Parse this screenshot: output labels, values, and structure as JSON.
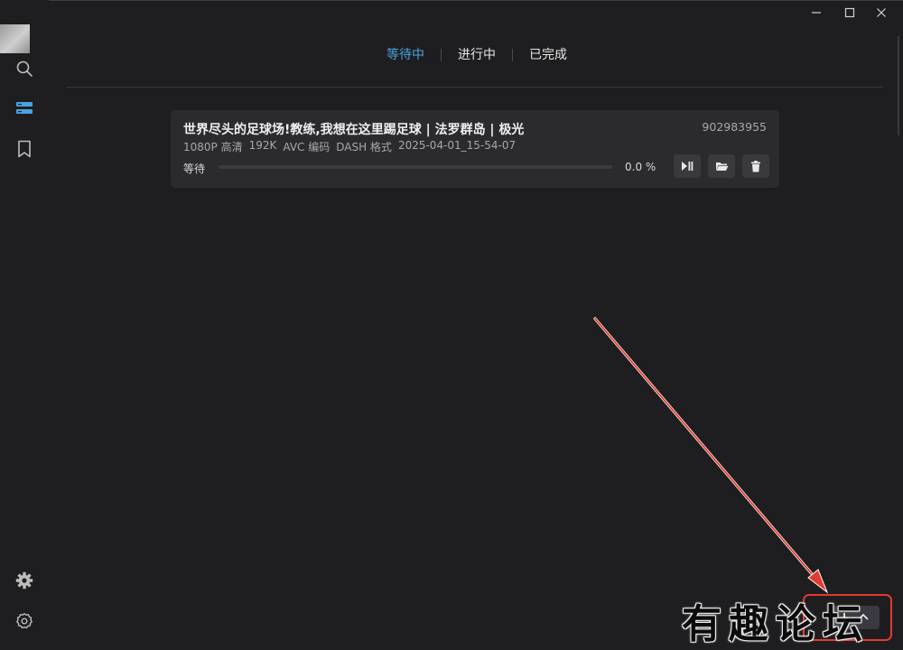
{
  "window": {
    "controls": [
      {
        "name": "minimize-icon"
      },
      {
        "name": "maximize-icon"
      },
      {
        "name": "close-icon"
      }
    ]
  },
  "sidebar": {
    "items": [
      {
        "name": "search-icon",
        "active": false
      },
      {
        "name": "download-list-icon",
        "active": true
      },
      {
        "name": "bookmark-icon",
        "active": false
      }
    ],
    "bottom_items": [
      {
        "name": "theme-gear-icon"
      },
      {
        "name": "settings-icon"
      }
    ]
  },
  "tabs": [
    {
      "label": "等待中",
      "active": true
    },
    {
      "label": "进行中",
      "active": false
    },
    {
      "label": "已完成",
      "active": false
    }
  ],
  "card": {
    "title": "世界尽头的足球场!教练,我想在这里踢足球 | 法罗群岛 | 极光",
    "id": "902983955",
    "meta": [
      "1080P 高清",
      "192K",
      "AVC 编码",
      "DASH 格式",
      "2025-04-01_15-54-07"
    ],
    "status": "等待",
    "progress": 0.0,
    "percent_text": "0.0 %",
    "buttons": [
      {
        "name": "play-pause-icon"
      },
      {
        "name": "folder-icon"
      },
      {
        "name": "delete-icon"
      }
    ]
  },
  "download_control": {
    "icons": [
      "download-arrow-icon",
      "collapse-icon"
    ]
  },
  "watermark": {
    "text": "有趣论坛"
  },
  "colors": {
    "background": "#1e1e20",
    "card": "#2b2b2e",
    "accent": "#4aa3df",
    "annotation_red": "#e23a2e"
  }
}
